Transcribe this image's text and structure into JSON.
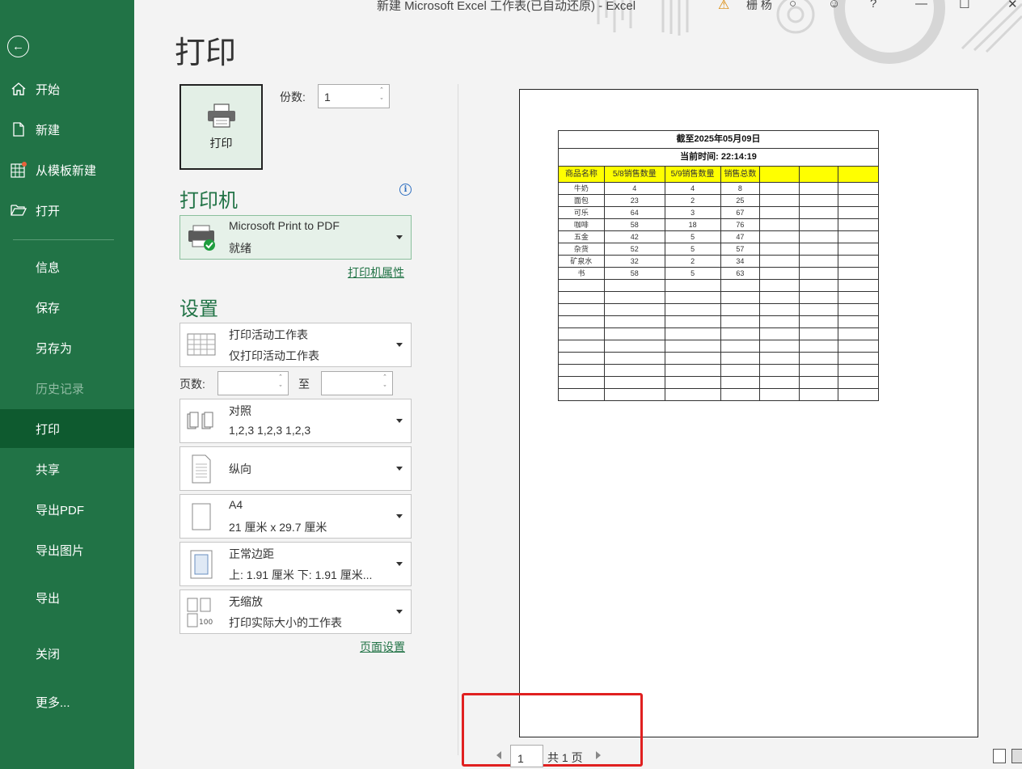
{
  "window": {
    "title": "新建 Microsoft Excel 工作表(已自动还原)  -  Excel",
    "user": "栅 杨",
    "help": "?",
    "minimize": "—",
    "restore": "☐",
    "close": "✕"
  },
  "sidebar": {
    "back_icon": "arrow-left-icon",
    "items": [
      {
        "label": "开始",
        "icon": "home-icon"
      },
      {
        "label": "新建",
        "icon": "new-file-icon"
      },
      {
        "label": "从模板新建",
        "icon": "template-icon"
      },
      {
        "label": "打开",
        "icon": "folder-icon"
      },
      {
        "label": "信息"
      },
      {
        "label": "保存"
      },
      {
        "label": "另存为"
      },
      {
        "label": "历史记录"
      },
      {
        "label": "打印"
      },
      {
        "label": "共享"
      },
      {
        "label": "导出PDF"
      },
      {
        "label": "导出图片"
      },
      {
        "label": "导出"
      },
      {
        "label": "关闭"
      },
      {
        "label": "更多..."
      }
    ]
  },
  "print": {
    "title": "打印",
    "button_label": "打印",
    "copies_label": "份数:",
    "copies_value": "1",
    "printer_heading": "打印机",
    "printer_name": "Microsoft Print to PDF",
    "printer_status": "就绪",
    "printer_props_link": "打印机属性",
    "settings_heading": "设置",
    "settings": {
      "scope_title": "打印活动工作表",
      "scope_desc": "仅打印活动工作表",
      "pages_label": "页数:",
      "to_label": "至",
      "collate_title": "对照",
      "collate_desc": "1,2,3    1,2,3    1,2,3",
      "orientation": "纵向",
      "paper_title": "A4",
      "paper_desc": "21 厘米 x 29.7 厘米",
      "margins_title": "正常边距",
      "margins_desc": "上: 1.91 厘米 下: 1.91 厘米...",
      "scaling_title": "无缩放",
      "scaling_desc": "打印实际大小的工作表",
      "scaling_icon_text": "100"
    },
    "page_setup_link": "页面设置"
  },
  "preview": {
    "sheet": {
      "title": "截至2025年05月09日",
      "subtitle": "当前时间:  22:14:19",
      "headers": [
        "商品名称",
        "5/8销售数量",
        "5/9销售数量",
        "销售总数",
        "",
        "",
        ""
      ],
      "rows": [
        [
          "牛奶",
          "4",
          "4",
          "8"
        ],
        [
          "面包",
          "23",
          "2",
          "25"
        ],
        [
          "可乐",
          "64",
          "3",
          "67"
        ],
        [
          "咖啡",
          "58",
          "18",
          "76"
        ],
        [
          "五金",
          "42",
          "5",
          "47"
        ],
        [
          "杂货",
          "52",
          "5",
          "57"
        ],
        [
          "矿泉水",
          "32",
          "2",
          "34"
        ],
        [
          "书",
          "58",
          "5",
          "63"
        ]
      ],
      "blank_rows": 10
    },
    "pager": {
      "current": "1",
      "total": "共 1 页"
    }
  }
}
